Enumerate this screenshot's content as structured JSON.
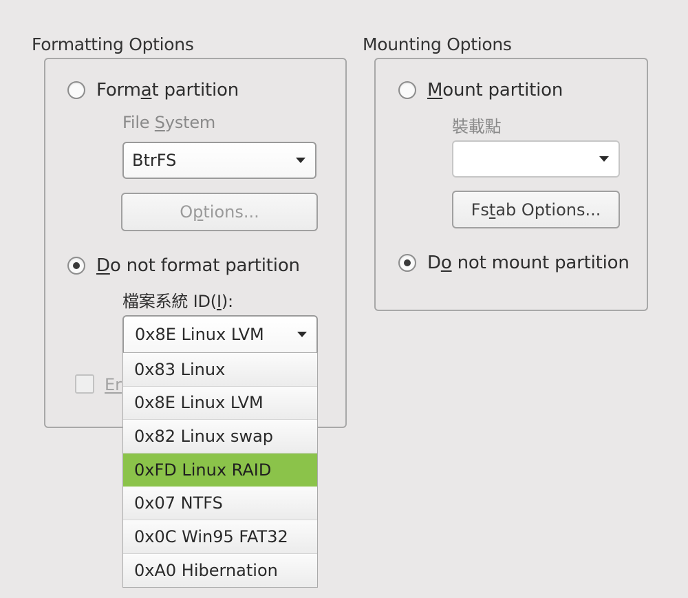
{
  "formatting": {
    "title": "Formatting Options",
    "format_radio": {
      "label_pre": "Form",
      "label_mnemonic": "a",
      "label_post": "t partition",
      "checked": false
    },
    "file_system_label": {
      "pre": "File ",
      "mnemonic": "S",
      "post": "ystem"
    },
    "file_system_value": "BtrFS",
    "options_button": {
      "pre": "O",
      "mnemonic": "p",
      "post": "tions..."
    },
    "no_format_radio": {
      "label_mnemonic": "D",
      "label_post": "o not format partition",
      "checked": true
    },
    "fs_id_label": {
      "pre": "檔案系統 ID(",
      "mnemonic": "I",
      "post": "):"
    },
    "fs_id_value": "0x8E Linux LVM",
    "encrypt_checkbox_label_visible": "Er",
    "fs_id_options": [
      "0x83 Linux",
      "0x8E Linux LVM",
      "0x82 Linux swap",
      "0xFD Linux RAID",
      "0x07 NTFS",
      "0x0C Win95 FAT32",
      "0xA0 Hibernation"
    ],
    "highlighted_option": "0xFD Linux RAID"
  },
  "mounting": {
    "title": "Mounting Options",
    "mount_radio": {
      "label_mnemonic": "M",
      "label_post": "ount partition",
      "checked": false
    },
    "mount_point_label": "裝載點",
    "mount_point_value": "",
    "fstab_button": {
      "pre": "Fs",
      "mnemonic": "t",
      "post": "ab Options..."
    },
    "no_mount_radio": {
      "label_pre": "D",
      "label_mnemonic": "o",
      "label_post": " not mount partition",
      "checked": true
    }
  },
  "colors": {
    "highlight": "#8bc34a",
    "background": "#eae8e8"
  }
}
